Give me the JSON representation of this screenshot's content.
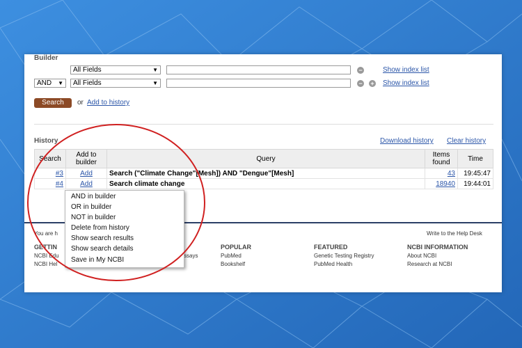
{
  "builder": {
    "title": "Builder",
    "row1_field": "All Fields",
    "row2_op": "AND",
    "row2_field": "All Fields",
    "show_index_1": "Show index list",
    "show_index_2": "Show index list",
    "search_btn": "Search",
    "or_text": "or",
    "add_history": "Add to history"
  },
  "history": {
    "title": "History",
    "download": "Download history",
    "clear": "Clear history",
    "columns": [
      "Search",
      "Add to builder",
      "Query",
      "Items found",
      "Time"
    ],
    "rows": [
      {
        "id": "#3",
        "add": "Add",
        "query": "Search (\"Climate Change\"[Mesh]) AND \"Dengue\"[Mesh]",
        "items": "43",
        "time": "19:45:47"
      },
      {
        "id": "#4",
        "add": "Add",
        "query": "Search climate change",
        "items": "18940",
        "time": "19:44:01"
      }
    ]
  },
  "menu": [
    "AND in builder",
    "OR in builder",
    "NOT in builder",
    "Delete from history",
    "Show search results",
    "Show search details",
    "Save in My NCBI"
  ],
  "footer": {
    "you_are": "You are h",
    "help": "Write to the Help Desk",
    "getting": "GETTIN",
    "getting_l1": "NCBI Edu",
    "getting_l2": "NCBI Hel",
    "essays": "ssays",
    "popular": "POPULAR",
    "popular_items": [
      "PubMed",
      "Bookshelf"
    ],
    "featured": "FEATURED",
    "featured_items": [
      "Genetic Testing Registry",
      "PubMed Health"
    ],
    "ncbi_info": "NCBI INFORMATION",
    "ncbi_items": [
      "About NCBI",
      "Research at NCBI"
    ]
  },
  "colors": {
    "accent": "#8c4a26",
    "link": "#2a55a8",
    "annotation": "#d02020"
  }
}
